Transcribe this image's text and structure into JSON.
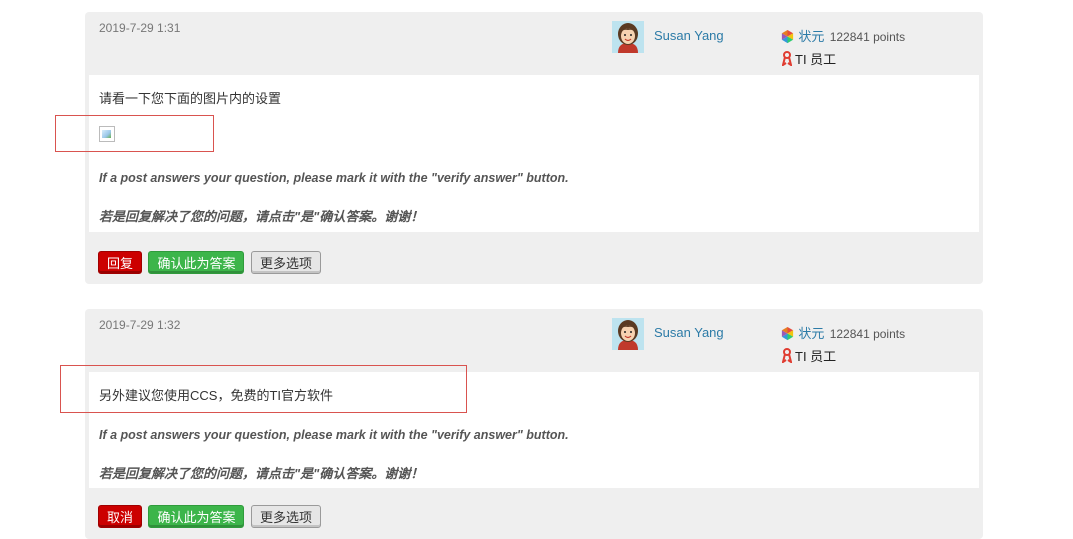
{
  "posts": [
    {
      "timestamp": "2019-7-29 1:31",
      "author": "Susan Yang",
      "rank": "状元",
      "points": "122841 points",
      "staff_label": "TI 员工",
      "body_text": "请看一下您下面的图片内的设置",
      "signature_en": "If a post answers your question, please mark it with the \"verify answer\" button.",
      "signature_zh": "若是回复解决了您的问题，请点击\"是\"确认答案。谢谢！",
      "buttons": {
        "reply": "回复",
        "verify": "确认此为答案",
        "more": "更多选项"
      }
    },
    {
      "timestamp": "2019-7-29 1:32",
      "author": "Susan Yang",
      "rank": "状元",
      "points": "122841 points",
      "staff_label": "TI 员工",
      "body_text": "另外建议您使用CCS，免费的TI官方软件",
      "signature_en": "If a post answers your question, please mark it with the \"verify answer\" button.",
      "signature_zh": "若是回复解决了您的问题，请点击\"是\"确认答案。谢谢！",
      "buttons": {
        "reply": "取消",
        "verify": "确认此为答案",
        "more": "更多选项"
      }
    }
  ],
  "icons": {
    "avatar": "woman-avatar-icon",
    "rank": "hexagon-rank-icon",
    "staff": "red-ribbon-icon",
    "broken_image": "broken-image-icon"
  },
  "colors": {
    "link": "#2c7ba7",
    "reply_button": "#cc0000",
    "verify_button": "#3cb54a",
    "highlight": "#d9534f"
  }
}
